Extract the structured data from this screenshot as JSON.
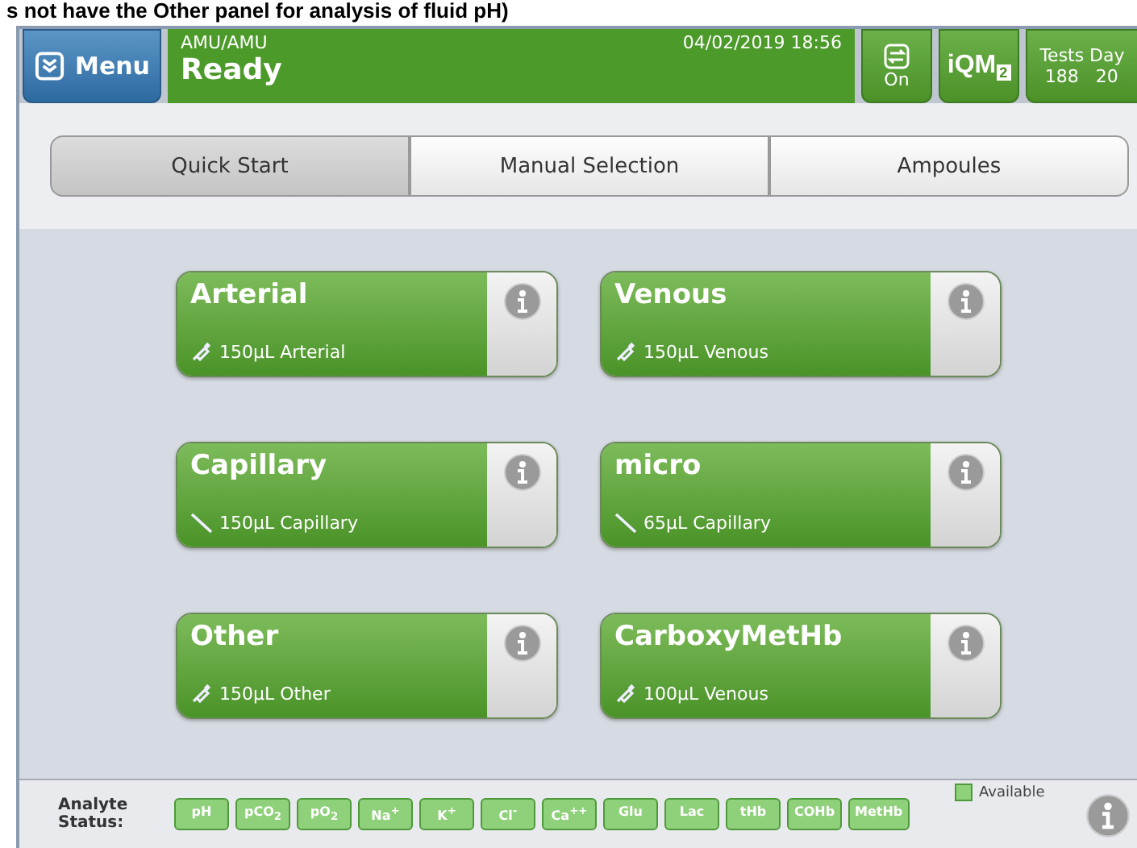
{
  "caption": "s not have the Other panel for analysis of fluid pH)",
  "header": {
    "menu": "Menu",
    "device": "AMU/AMU",
    "status": "Ready",
    "datetime": "04/02/2019 18:56",
    "sync": "On",
    "iqm": "iQM",
    "iqm_badge": "2",
    "tests_label": "Tests",
    "tests": "188",
    "days_label": "Day",
    "days": "20"
  },
  "tabs": [
    {
      "label": "Quick Start",
      "selected": true
    },
    {
      "label": "Manual Selection",
      "selected": false
    },
    {
      "label": "Ampoules",
      "selected": false
    }
  ],
  "panels": [
    {
      "title": "Arterial",
      "detail": "150µL Arterial",
      "kind": "syringe"
    },
    {
      "title": "Venous",
      "detail": "150µL Venous",
      "kind": "syringe"
    },
    {
      "title": "Capillary",
      "detail": "150µL Capillary",
      "kind": "capillary"
    },
    {
      "title": "micro",
      "detail": "65µL Capillary",
      "kind": "capillary"
    },
    {
      "title": "Other",
      "detail": "150µL Other",
      "kind": "syringe"
    },
    {
      "title": "CarboxyMetHb",
      "detail": "100µL Venous",
      "kind": "syringe"
    }
  ],
  "footer": {
    "label": "Analyte Status:",
    "legend": "Available",
    "analytes": [
      "pH",
      "pCO$_{2}$",
      "pO$_{2}$",
      "Na$^{+}$",
      "K$^{+}$",
      "Cl$^{-}$",
      "Ca$^{++}$",
      "Glu",
      "Lac",
      "tHb",
      "COHb",
      "MetHb"
    ]
  }
}
